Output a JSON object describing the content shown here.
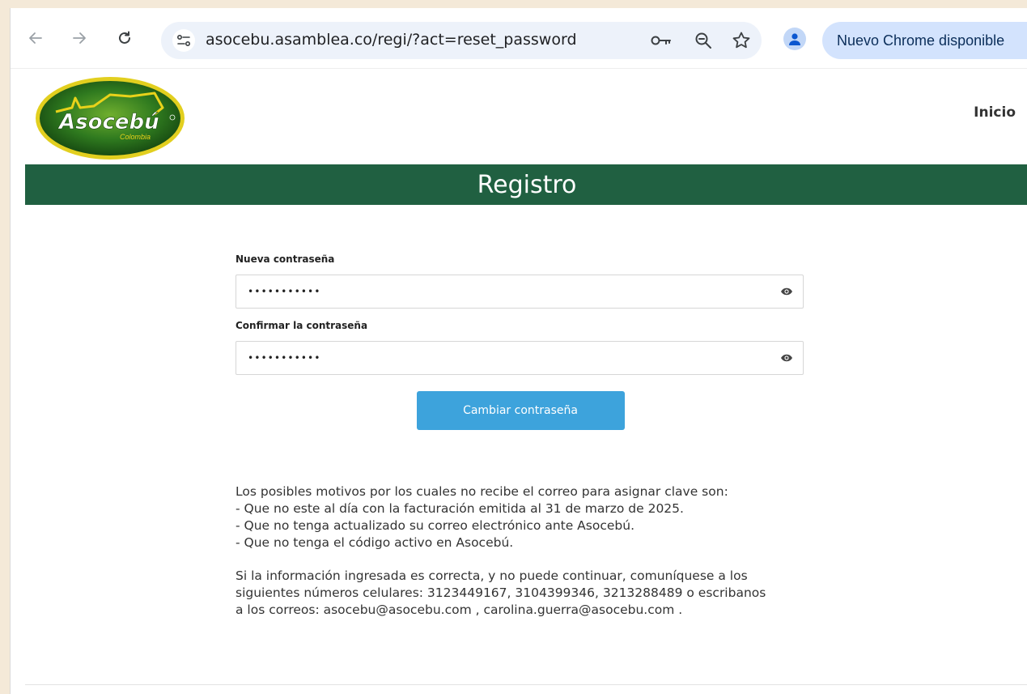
{
  "browser": {
    "back_label": "←",
    "forward_label": "→",
    "reload_label": "C",
    "url": "asocebu.asamblea.co/regi/?act=reset_password",
    "update_chip": "Nuevo Chrome disponible"
  },
  "header": {
    "logo_text": "Asocebú",
    "logo_subtext": "Colombia",
    "nav_home": "Inicio"
  },
  "banner": {
    "title": "Registro"
  },
  "form": {
    "new_password_label": "Nueva contraseña",
    "new_password_value": "•••••••••••",
    "confirm_password_label": "Confirmar la contraseña",
    "confirm_password_value": "•••••••••••",
    "submit_label": "Cambiar contraseña"
  },
  "info": {
    "reasons_intro": "Los posibles motivos por los cuales no recibe el correo para asignar clave son:",
    "reasons": [
      "- Que no este al día con la facturación emitida al 31 de marzo de 2025.",
      "- Que no tenga actualizado su correo electrónico ante Asocebú.",
      "- Que no tenga el código activo en Asocebú."
    ],
    "contact_lines": [
      "Si la información ingresada es correcta, y no puede continuar, comuníquese a los",
      "siguientes números celulares: 3123449167, 3104399346, 3213288489 o escribanos",
      "a los correos: asocebu@asocebu.com , carolina.guerra@asocebu.com ."
    ]
  },
  "colors": {
    "banner": "#206041",
    "button": "#3da3dc",
    "logo_green": "#2f7a1f",
    "logo_gold": "#e8d21a"
  }
}
